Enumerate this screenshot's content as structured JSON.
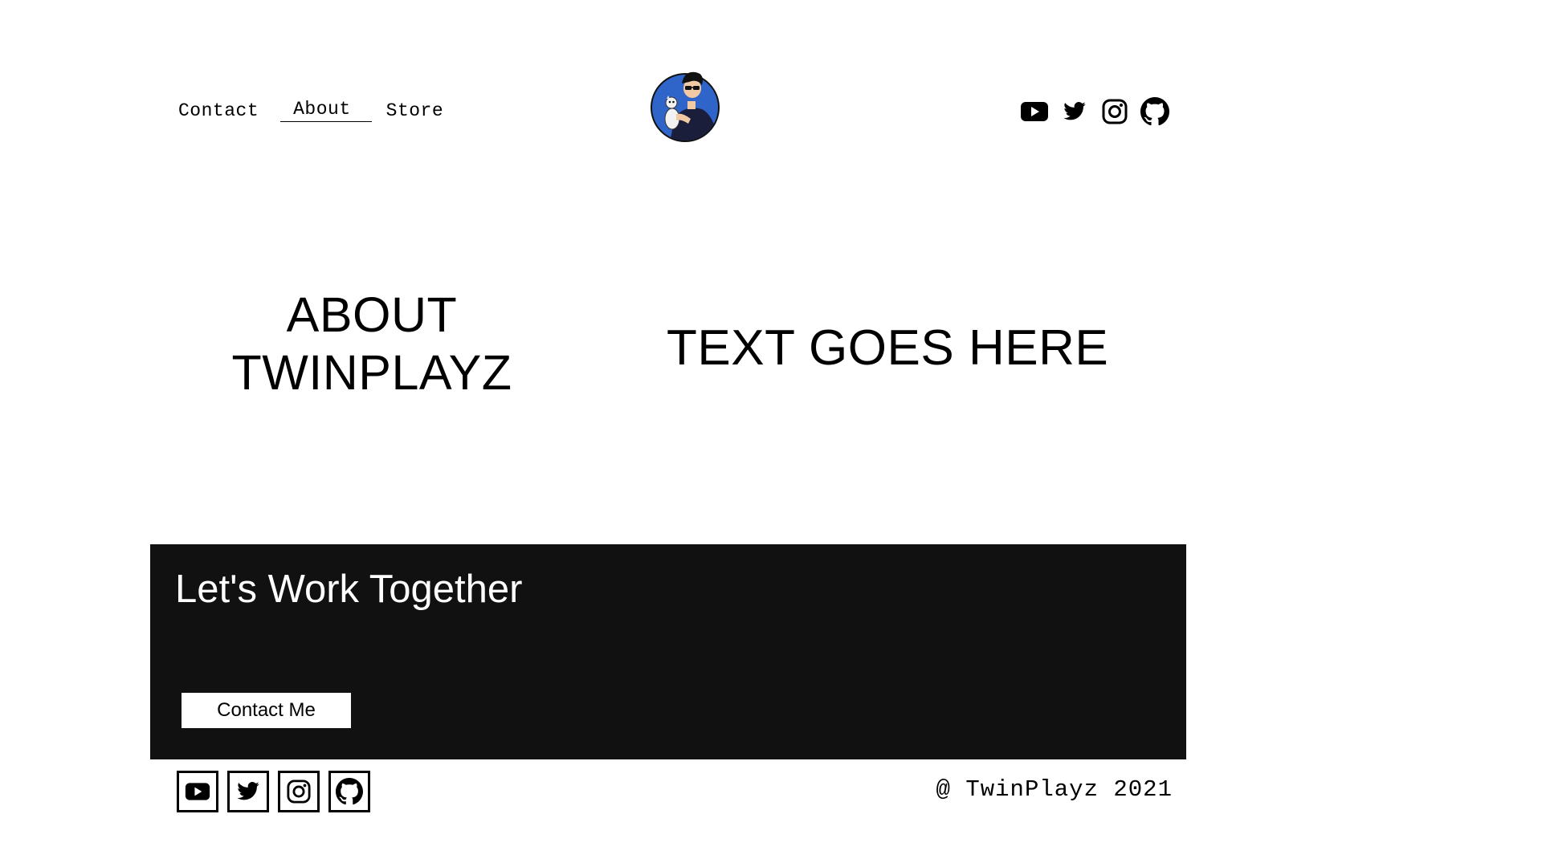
{
  "header": {
    "nav": [
      {
        "label": "Contact",
        "active": false
      },
      {
        "label": "About",
        "active": true
      },
      {
        "label": "Store",
        "active": false
      }
    ],
    "avatar_icon": "character-avatar",
    "social": [
      "youtube-icon",
      "twitter-icon",
      "instagram-icon",
      "github-icon"
    ]
  },
  "hero": {
    "title_line1": "ABOUT",
    "title_line2": "TWINPLAYZ",
    "body": "TEXT GOES HERE"
  },
  "cta": {
    "heading": "Let's Work Together",
    "button_label": "Contact Me",
    "background": "#111111"
  },
  "footer": {
    "social": [
      "youtube-icon",
      "twitter-icon",
      "instagram-icon",
      "github-icon"
    ],
    "copyright": "@ TwinPlayz 2021"
  }
}
